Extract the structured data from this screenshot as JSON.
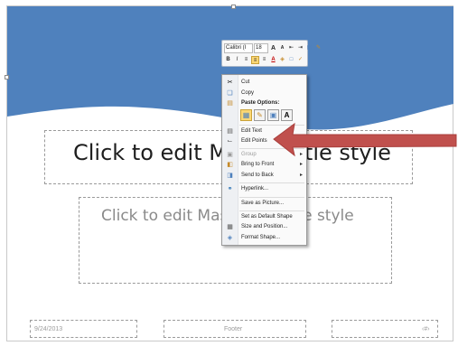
{
  "mini_toolbar": {
    "font_name": "Calibri (I",
    "font_size": "18",
    "grow_font": "A",
    "shrink_font": "A",
    "bold": "B",
    "italic": "I",
    "font_color_label": "A"
  },
  "context_menu": {
    "items": [
      {
        "label": "Cut",
        "icon": "scissors-icon"
      },
      {
        "label": "Copy",
        "icon": "copy-icon"
      },
      {
        "label": "Paste Options:",
        "icon": "paste-icon"
      },
      {
        "label": "Edit Text",
        "icon": "edit-text-icon"
      },
      {
        "label": "Edit Points",
        "icon": "edit-points-icon"
      },
      {
        "label": "Group",
        "icon": "group-icon",
        "disabled": true
      },
      {
        "label": "Bring to Front",
        "icon": "bring-to-front-icon"
      },
      {
        "label": "Send to Back",
        "icon": "send-to-back-icon"
      },
      {
        "label": "Hyperlink...",
        "icon": "hyperlink-icon"
      },
      {
        "label": "Save as Picture...",
        "icon": ""
      },
      {
        "label": "Set as Default Shape",
        "icon": ""
      },
      {
        "label": "Size and Position...",
        "icon": "size-position-icon"
      },
      {
        "label": "Format Shape...",
        "icon": "format-shape-icon"
      }
    ],
    "paste_options": [
      "",
      "",
      "",
      "A"
    ]
  },
  "slide": {
    "title_placeholder": "Click to edit Master title style",
    "subtitle_placeholder": "Click to edit Master subtitle style",
    "footer": {
      "date": "9/24/2013",
      "footer_text": "Footer",
      "slide_number": "‹#›"
    }
  },
  "colors": {
    "shape_fill": "#4f81bd",
    "arrow": "#c0504d",
    "highlight": "#fbd775"
  }
}
